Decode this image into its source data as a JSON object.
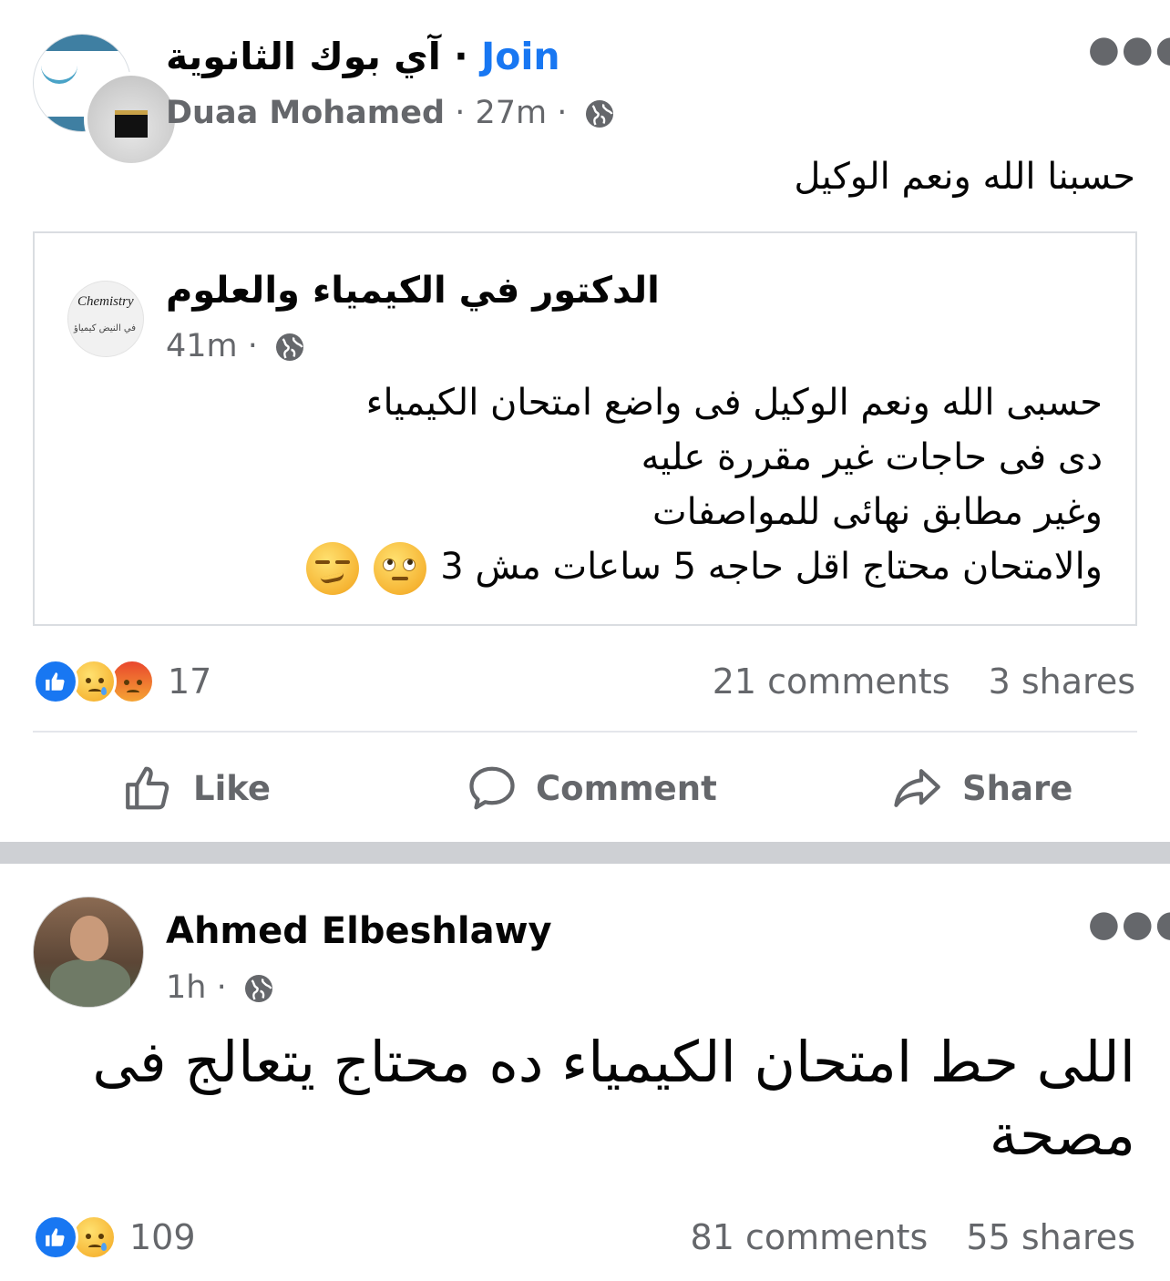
{
  "post1": {
    "group_name": "آي بوك الثانوية",
    "separator": "·",
    "join_label": "Join",
    "author": "Duaa Mohamed",
    "time": "27m",
    "text": "حسبنا الله ونعم الوكيل",
    "more_icon": "more-dots-icon",
    "shared": {
      "page_name": "الدكتور في الكيمياء والعلوم",
      "time": "41m",
      "avatar_text": "Chemistry",
      "avatar_subtext": "في النيض كيمياؤ",
      "lines": [
        "حسبى الله ونعم الوكيل فى واضع امتحان الكيمياء",
        "دى فى حاجات غير مقررة عليه",
        "وغير مطابق نهائى للمواصفات",
        "والامتحان محتاج اقل حاجه 5 ساعات مش 3"
      ],
      "emojis": [
        "eye-roll-emoji-icon",
        "smirk-emoji-icon"
      ]
    },
    "reaction_count": "17",
    "reactions": [
      "like-reaction-icon",
      "sad-reaction-icon",
      "angry-reaction-icon"
    ],
    "comments": "21 comments",
    "shares": "3 shares"
  },
  "actions": {
    "like": "Like",
    "comment": "Comment",
    "share": "Share"
  },
  "post2": {
    "author": "Ahmed Elbeshlawy",
    "time": "1h",
    "text": "اللى حط امتحان الكيمياء ده محتاج يتعالج فى مصحة",
    "reaction_count": "109",
    "reactions": [
      "like-reaction-icon",
      "sad-reaction-icon"
    ],
    "comments": "81 comments",
    "shares": "55 shares"
  },
  "colors": {
    "link": "#1877f2",
    "muted": "#65676b",
    "separator": "#ced0d4"
  }
}
